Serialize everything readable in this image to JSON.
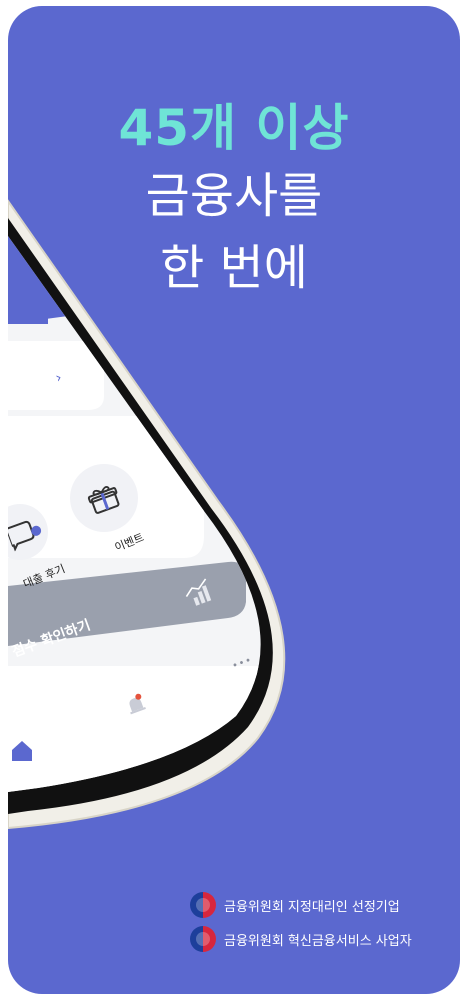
{
  "headline": {
    "line1": "45개 이상",
    "line2": "금융사를",
    "line3": "한 번에"
  },
  "phone_screen": {
    "chevron": "›",
    "menu_items": [
      {
        "label": "대출 후기",
        "icon": "chat-bubble-icon"
      },
      {
        "label": "이벤트",
        "icon": "gift-icon"
      }
    ],
    "banner_text": "점수 확인하기",
    "more_icon": "•••"
  },
  "footer": {
    "line1": "금융위원회 지정대리인 선정기업",
    "line2": "금융위원회 혁신금융서비스 사업자"
  },
  "colors": {
    "background": "#5b68cf",
    "headline_accent": "#6fe4d6",
    "phone_frame": "#f1efe8"
  }
}
